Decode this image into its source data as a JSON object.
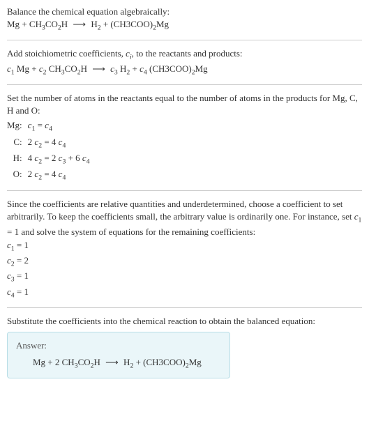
{
  "intro": {
    "title": "Balance the chemical equation algebraically:",
    "lhs1": "Mg",
    "plus": " + ",
    "lhs2_a": "CH",
    "lhs2_b": "3",
    "lhs2_c": "CO",
    "lhs2_d": "2",
    "lhs2_e": "H",
    "arrow": "⟶",
    "rhs1_a": "H",
    "rhs1_b": "2",
    "rhs2_a": "(CH3COO)",
    "rhs2_b": "2",
    "rhs2_c": "Mg"
  },
  "stoich": {
    "text_a": "Add stoichiometric coefficients, ",
    "ci_c": "c",
    "ci_i": "i",
    "text_b": ", to the reactants and products:",
    "c1": "c",
    "n1": "1",
    "sp1": " Mg",
    "c2": "c",
    "n2": "2",
    "sp2_a": " CH",
    "sp2_b": "3",
    "sp2_c": "CO",
    "sp2_d": "2",
    "sp2_e": "H",
    "c3": "c",
    "n3": "3",
    "sp3_a": " H",
    "sp3_b": "2",
    "c4": "c",
    "n4": "4",
    "sp4_a": " (CH3COO)",
    "sp4_b": "2",
    "sp4_c": "Mg"
  },
  "atoms": {
    "text": "Set the number of atoms in the reactants equal to the number of atoms in the products for Mg, C, H and O:",
    "rows": [
      {
        "el": "Mg:",
        "lhs_c": "c",
        "lhs_n": "1",
        "mid": " = ",
        "rhs_c": "c",
        "rhs_n": "4",
        "pre": "",
        "extra": ""
      },
      {
        "el": "C:",
        "pre": "2 ",
        "lhs_c": "c",
        "lhs_n": "2",
        "mid": " = 4 ",
        "rhs_c": "c",
        "rhs_n": "4",
        "extra": ""
      },
      {
        "el": "H:",
        "pre": "4 ",
        "lhs_c": "c",
        "lhs_n": "2",
        "mid": " = 2 ",
        "rhs_c": "c",
        "rhs_n": "3",
        "extra_a": " + 6 ",
        "extra_c": "c",
        "extra_n": "4"
      },
      {
        "el": "O:",
        "pre": "2 ",
        "lhs_c": "c",
        "lhs_n": "2",
        "mid": " = 4 ",
        "rhs_c": "c",
        "rhs_n": "4",
        "extra": ""
      }
    ]
  },
  "solve": {
    "text_a": "Since the coefficients are relative quantities and underdetermined, choose a coefficient to set arbitrarily. To keep the coefficients small, the arbitrary value is ordinarily one. For instance, set ",
    "set_c": "c",
    "set_n": "1",
    "text_b": " = 1 and solve the system of equations for the remaining coefficients:",
    "coefs": [
      {
        "c": "c",
        "n": "1",
        "eq": " = 1"
      },
      {
        "c": "c",
        "n": "2",
        "eq": " = 2"
      },
      {
        "c": "c",
        "n": "3",
        "eq": " = 1"
      },
      {
        "c": "c",
        "n": "4",
        "eq": " = 1"
      }
    ]
  },
  "final": {
    "text": "Substitute the coefficients into the chemical reaction to obtain the balanced equation:",
    "answer_label": "Answer:",
    "eq_a": "Mg + 2 CH",
    "eq_b": "3",
    "eq_c": "CO",
    "eq_d": "2",
    "eq_e": "H",
    "arrow": "⟶",
    "eq_f": "H",
    "eq_g": "2",
    "eq_h": " + (CH3COO)",
    "eq_i": "2",
    "eq_j": "Mg"
  }
}
